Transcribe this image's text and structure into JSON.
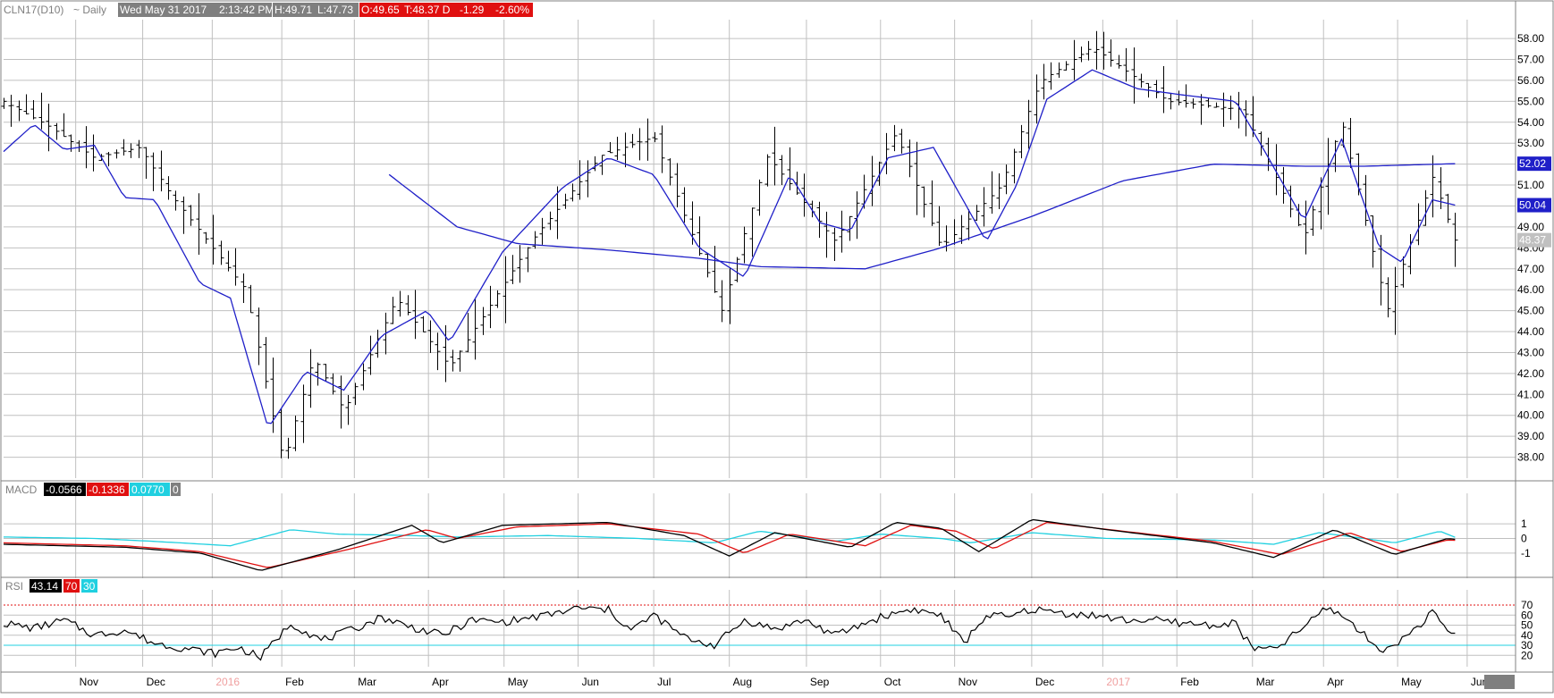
{
  "header": {
    "symbol": "CLN17(D10)",
    "period": "~ Daily",
    "datetime": "Wed May 31 2017",
    "time": "2:13:42 PM",
    "high": "H:49.71",
    "low": "L:47.73",
    "open": "O:49.65",
    "last": "T:48.37 D",
    "change": "-1.29",
    "change_pct": "-2.60%"
  },
  "colors": {
    "background": "#ffffff",
    "grid": "#c0c0c0",
    "bars": "#000000",
    "ma_fast": "#1f1fc8",
    "ma_slow": "#1f1fc8",
    "macd_line": "#000000",
    "macd_signal": "#e01010",
    "macd_hist": "#20d0e0",
    "rsi_line": "#000000",
    "rsi_70": "#e01010",
    "rsi_30": "#20d0e0",
    "header_bg": "#7f7f7f",
    "header_red": "#e01010"
  },
  "macd": {
    "label": "MACD",
    "v1": "-0.0566",
    "v2": "-0.1336",
    "v3": "0.0770",
    "v4": "0"
  },
  "rsi": {
    "label": "RSI",
    "v1": "43.14",
    "v2": "70",
    "v3": "30"
  },
  "price_axis_labels": {
    "ma_slow": "52.02",
    "ma_fast": "50.04",
    "last": "48.37"
  },
  "chart_data": [
    {
      "type": "bar",
      "subtype": "ohlc",
      "x_tick_labels": [
        "Nov",
        "Dec",
        "2016",
        "Feb",
        "Mar",
        "Apr",
        "May",
        "Jun",
        "Jul",
        "Aug",
        "Sep",
        "Oct",
        "Nov",
        "Dec",
        "2017",
        "Feb",
        "Mar",
        "Apr",
        "May",
        "Jun"
      ],
      "y_ticks": [
        "38.00",
        "39.00",
        "40.00",
        "41.00",
        "42.00",
        "43.00",
        "44.00",
        "45.00",
        "46.00",
        "47.00",
        "48.00",
        "49.00",
        "50.00",
        "51.00",
        "52.00",
        "53.00",
        "54.00",
        "55.00",
        "56.00",
        "57.00",
        "58.00"
      ],
      "ylim": [
        37.0,
        58.9
      ],
      "grid": true,
      "anchors": [
        [
          0,
          55.0
        ],
        [
          0.03,
          53.8
        ],
        [
          0.06,
          52.3
        ],
        [
          0.09,
          52.8
        ],
        [
          0.11,
          50.6
        ],
        [
          0.16,
          46.0
        ],
        [
          0.185,
          37.7
        ],
        [
          0.205,
          42.8
        ],
        [
          0.225,
          40.2
        ],
        [
          0.26,
          45.6
        ],
        [
          0.295,
          42.3
        ],
        [
          0.35,
          48.4
        ],
        [
          0.395,
          52.4
        ],
        [
          0.43,
          53.3
        ],
        [
          0.475,
          45.0
        ],
        [
          0.505,
          52.4
        ],
        [
          0.55,
          48.3
        ],
        [
          0.59,
          53.5
        ],
        [
          0.62,
          48.0
        ],
        [
          0.66,
          51.0
        ],
        [
          0.685,
          55.9
        ],
        [
          0.72,
          57.6
        ],
        [
          0.77,
          55.0
        ],
        [
          0.82,
          54.6
        ],
        [
          0.86,
          48.5
        ],
        [
          0.885,
          54.0
        ],
        [
          0.915,
          45.0
        ],
        [
          0.945,
          51.4
        ],
        [
          0.96,
          48.37
        ]
      ],
      "series": [
        {
          "name": "MA fast",
          "anchors": [
            [
              0,
              52.6
            ],
            [
              0.02,
              53.9
            ],
            [
              0.04,
              52.7
            ],
            [
              0.06,
              52.9
            ],
            [
              0.08,
              50.4
            ],
            [
              0.1,
              50.3
            ],
            [
              0.13,
              46.3
            ],
            [
              0.15,
              45.6
            ],
            [
              0.175,
              39.4
            ],
            [
              0.2,
              42.1
            ],
            [
              0.225,
              41.2
            ],
            [
              0.25,
              43.8
            ],
            [
              0.28,
              45.0
            ],
            [
              0.295,
              43.5
            ],
            [
              0.33,
              47.8
            ],
            [
              0.37,
              50.9
            ],
            [
              0.4,
              52.3
            ],
            [
              0.43,
              51.5
            ],
            [
              0.46,
              48.0
            ],
            [
              0.49,
              46.6
            ],
            [
              0.52,
              51.5
            ],
            [
              0.54,
              49.2
            ],
            [
              0.56,
              48.8
            ],
            [
              0.585,
              52.3
            ],
            [
              0.615,
              52.8
            ],
            [
              0.65,
              48.3
            ],
            [
              0.67,
              51.0
            ],
            [
              0.69,
              55.1
            ],
            [
              0.72,
              56.5
            ],
            [
              0.75,
              55.6
            ],
            [
              0.78,
              55.3
            ],
            [
              0.815,
              55.0
            ],
            [
              0.835,
              52.5
            ],
            [
              0.86,
              49.3
            ],
            [
              0.885,
              53.2
            ],
            [
              0.91,
              48.0
            ],
            [
              0.925,
              47.3
            ],
            [
              0.945,
              50.3
            ],
            [
              0.96,
              50.04
            ]
          ]
        },
        {
          "name": "MA slow",
          "anchors": [
            [
              0.255,
              51.5
            ],
            [
              0.3,
              49.0
            ],
            [
              0.34,
              48.2
            ],
            [
              0.4,
              47.9
            ],
            [
              0.46,
              47.5
            ],
            [
              0.5,
              47.1
            ],
            [
              0.57,
              47.0
            ],
            [
              0.62,
              48.0
            ],
            [
              0.68,
              49.5
            ],
            [
              0.74,
              51.2
            ],
            [
              0.8,
              52.0
            ],
            [
              0.86,
              51.9
            ],
            [
              0.9,
              51.9
            ],
            [
              0.96,
              52.02
            ]
          ]
        }
      ]
    },
    {
      "type": "line",
      "name": "MACD",
      "y_ticks": [
        "1",
        "0",
        "-1"
      ],
      "ylim": [
        -2.6,
        2.6
      ],
      "series": [
        {
          "name": "MACD",
          "anchors": [
            [
              0,
              -0.4
            ],
            [
              0.08,
              -0.6
            ],
            [
              0.13,
              -1.0
            ],
            [
              0.17,
              -2.2
            ],
            [
              0.22,
              -0.8
            ],
            [
              0.27,
              0.9
            ],
            [
              0.29,
              -0.3
            ],
            [
              0.33,
              0.9
            ],
            [
              0.4,
              1.1
            ],
            [
              0.45,
              0.2
            ],
            [
              0.48,
              -1.2
            ],
            [
              0.51,
              0.4
            ],
            [
              0.56,
              -0.6
            ],
            [
              0.59,
              1.1
            ],
            [
              0.62,
              0.7
            ],
            [
              0.645,
              -0.9
            ],
            [
              0.68,
              1.3
            ],
            [
              0.73,
              0.6
            ],
            [
              0.8,
              -0.3
            ],
            [
              0.84,
              -1.3
            ],
            [
              0.88,
              0.6
            ],
            [
              0.92,
              -1.1
            ],
            [
              0.955,
              0.0
            ],
            [
              0.96,
              -0.06
            ]
          ]
        },
        {
          "name": "Signal",
          "anchors": [
            [
              0,
              -0.3
            ],
            [
              0.08,
              -0.5
            ],
            [
              0.13,
              -0.9
            ],
            [
              0.175,
              -2.0
            ],
            [
              0.23,
              -0.7
            ],
            [
              0.28,
              0.6
            ],
            [
              0.3,
              0.0
            ],
            [
              0.34,
              0.8
            ],
            [
              0.4,
              1.0
            ],
            [
              0.46,
              0.3
            ],
            [
              0.49,
              -1.0
            ],
            [
              0.52,
              0.3
            ],
            [
              0.57,
              -0.5
            ],
            [
              0.6,
              0.9
            ],
            [
              0.63,
              0.5
            ],
            [
              0.655,
              -0.7
            ],
            [
              0.69,
              1.1
            ],
            [
              0.74,
              0.5
            ],
            [
              0.8,
              -0.2
            ],
            [
              0.845,
              -1.1
            ],
            [
              0.89,
              0.4
            ],
            [
              0.925,
              -0.9
            ],
            [
              0.955,
              -0.1
            ],
            [
              0.96,
              -0.13
            ]
          ]
        },
        {
          "name": "Histogram",
          "anchors": [
            [
              0,
              0.1
            ],
            [
              0.06,
              0.0
            ],
            [
              0.1,
              -0.2
            ],
            [
              0.15,
              -0.5
            ],
            [
              0.19,
              0.6
            ],
            [
              0.22,
              0.3
            ],
            [
              0.27,
              0.2
            ],
            [
              0.3,
              0.1
            ],
            [
              0.36,
              0.2
            ],
            [
              0.42,
              0.0
            ],
            [
              0.47,
              -0.3
            ],
            [
              0.5,
              0.5
            ],
            [
              0.55,
              -0.2
            ],
            [
              0.58,
              0.3
            ],
            [
              0.62,
              0.0
            ],
            [
              0.64,
              -0.3
            ],
            [
              0.68,
              0.4
            ],
            [
              0.73,
              0.0
            ],
            [
              0.8,
              -0.1
            ],
            [
              0.84,
              -0.4
            ],
            [
              0.87,
              0.4
            ],
            [
              0.9,
              0.0
            ],
            [
              0.92,
              -0.3
            ],
            [
              0.95,
              0.5
            ],
            [
              0.96,
              0.08
            ]
          ]
        }
      ]
    },
    {
      "type": "line",
      "name": "RSI",
      "y_ticks": [
        "70",
        "60",
        "50",
        "40",
        "30",
        "20"
      ],
      "ylim": [
        14,
        78
      ],
      "levels": [
        70,
        30
      ],
      "series": [
        {
          "name": "RSI",
          "anchors": [
            [
              0,
              52
            ],
            [
              0.02,
              47
            ],
            [
              0.04,
              55
            ],
            [
              0.06,
              40
            ],
            [
              0.08,
              45
            ],
            [
              0.1,
              32
            ],
            [
              0.12,
              27
            ],
            [
              0.14,
              22
            ],
            [
              0.155,
              28
            ],
            [
              0.17,
              18
            ],
            [
              0.19,
              52
            ],
            [
              0.21,
              35
            ],
            [
              0.23,
              45
            ],
            [
              0.25,
              58
            ],
            [
              0.27,
              48
            ],
            [
              0.29,
              40
            ],
            [
              0.31,
              55
            ],
            [
              0.33,
              53
            ],
            [
              0.36,
              60
            ],
            [
              0.38,
              67
            ],
            [
              0.4,
              65
            ],
            [
              0.415,
              45
            ],
            [
              0.43,
              60
            ],
            [
              0.45,
              38
            ],
            [
              0.47,
              30
            ],
            [
              0.49,
              55
            ],
            [
              0.51,
              46
            ],
            [
              0.53,
              55
            ],
            [
              0.55,
              40
            ],
            [
              0.58,
              58
            ],
            [
              0.6,
              66
            ],
            [
              0.62,
              60
            ],
            [
              0.635,
              32
            ],
            [
              0.65,
              60
            ],
            [
              0.665,
              58
            ],
            [
              0.68,
              66
            ],
            [
              0.7,
              62
            ],
            [
              0.72,
              60
            ],
            [
              0.74,
              55
            ],
            [
              0.76,
              55
            ],
            [
              0.78,
              52
            ],
            [
              0.8,
              50
            ],
            [
              0.815,
              52
            ],
            [
              0.825,
              28
            ],
            [
              0.84,
              25
            ],
            [
              0.86,
              48
            ],
            [
              0.875,
              68
            ],
            [
              0.89,
              55
            ],
            [
              0.905,
              32
            ],
            [
              0.915,
              25
            ],
            [
              0.93,
              42
            ],
            [
              0.945,
              62
            ],
            [
              0.955,
              45
            ],
            [
              0.96,
              43.14
            ]
          ]
        }
      ]
    }
  ]
}
